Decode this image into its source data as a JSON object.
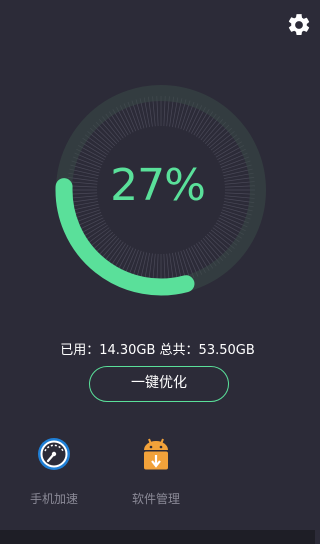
{
  "colors": {
    "background": "#2c2b38",
    "accent": "#5ae09a",
    "track": "#3a4a47",
    "label_gray": "#8b8a97"
  },
  "icons": {
    "settings": "gear-icon",
    "boost": "speedometer-icon",
    "apps": "android-download-icon"
  },
  "memory": {
    "percent_text": "27%",
    "used_fraction": 0.27,
    "usage_text": "已用：14.30GB 总共：53.50GB"
  },
  "actions": {
    "optimize_label": "一键优化"
  },
  "shortcuts": [
    {
      "label": "手机加速"
    },
    {
      "label": "软件管理"
    }
  ]
}
